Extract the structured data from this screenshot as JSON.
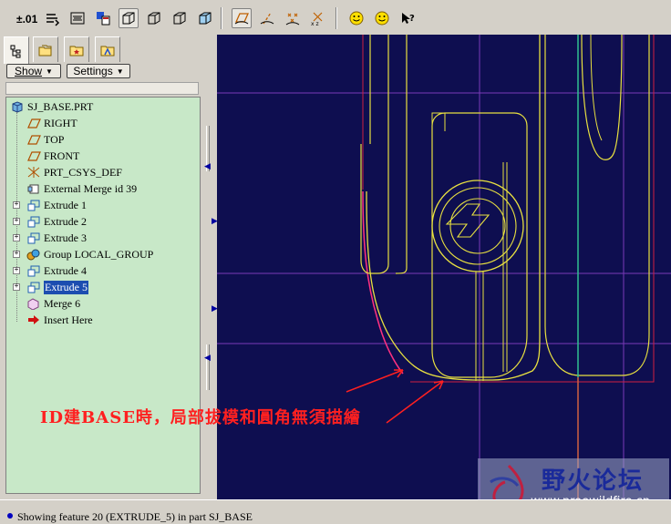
{
  "toolbar": {
    "precision_label": "±.01",
    "icons": [
      "regenerate-icon",
      "mapkey-icon",
      "window-icon",
      "view-icon",
      "shaded-icon",
      "hidden-line-icon",
      "no-hidden-icon",
      "wireframe-icon",
      "datum-plane-icon",
      "datum-axis-icon",
      "datum-point-icon",
      "csys-icon",
      "smile-icon",
      "smile-alt-icon",
      "context-help-icon"
    ]
  },
  "panel": {
    "tabs": [
      "model-tree-tab",
      "folder-browser-tab",
      "favorites-tab",
      "connections-tab"
    ],
    "show_label": "Show",
    "settings_label": "Settings"
  },
  "tree": {
    "root": "SJ_BASE.PRT",
    "items": [
      {
        "label": "RIGHT",
        "icon": "datum-plane-icon",
        "expandable": false,
        "selected": false
      },
      {
        "label": "TOP",
        "icon": "datum-plane-icon",
        "expandable": false,
        "selected": false
      },
      {
        "label": "FRONT",
        "icon": "datum-plane-icon",
        "expandable": false,
        "selected": false
      },
      {
        "label": "PRT_CSYS_DEF",
        "icon": "csys-icon",
        "expandable": false,
        "selected": false
      },
      {
        "label": "External Merge id 39",
        "icon": "merge-icon",
        "expandable": false,
        "selected": false
      },
      {
        "label": "Extrude 1",
        "icon": "extrude-icon",
        "expandable": true,
        "selected": false
      },
      {
        "label": "Extrude 2",
        "icon": "extrude-icon",
        "expandable": true,
        "selected": false
      },
      {
        "label": "Extrude 3",
        "icon": "extrude-icon",
        "expandable": true,
        "selected": false
      },
      {
        "label": "Group LOCAL_GROUP",
        "icon": "group-icon",
        "expandable": true,
        "selected": false
      },
      {
        "label": "Extrude 4",
        "icon": "extrude-icon",
        "expandable": true,
        "selected": false
      },
      {
        "label": "Extrude 5",
        "icon": "extrude-icon",
        "expandable": true,
        "selected": true
      },
      {
        "label": "Merge 6",
        "icon": "merge-6-icon",
        "expandable": false,
        "selected": false
      },
      {
        "label": "Insert Here",
        "icon": "insert-arrow-icon",
        "expandable": false,
        "selected": false
      }
    ]
  },
  "canvas": {
    "annotation": "ID建BASE時，局部拔模和圓角無須描繪",
    "background": "#0e0e50",
    "edge_color": "#e8e040",
    "datum_color": "#8040c0",
    "highlight_color": "#ff3060",
    "axis_color": "#40c0a0"
  },
  "status": {
    "message": "Showing feature 20 (EXTRUDE_5) in part SJ_BASE"
  },
  "watermark": {
    "title": "野火论坛",
    "url": "www.proewildfire.cn"
  }
}
